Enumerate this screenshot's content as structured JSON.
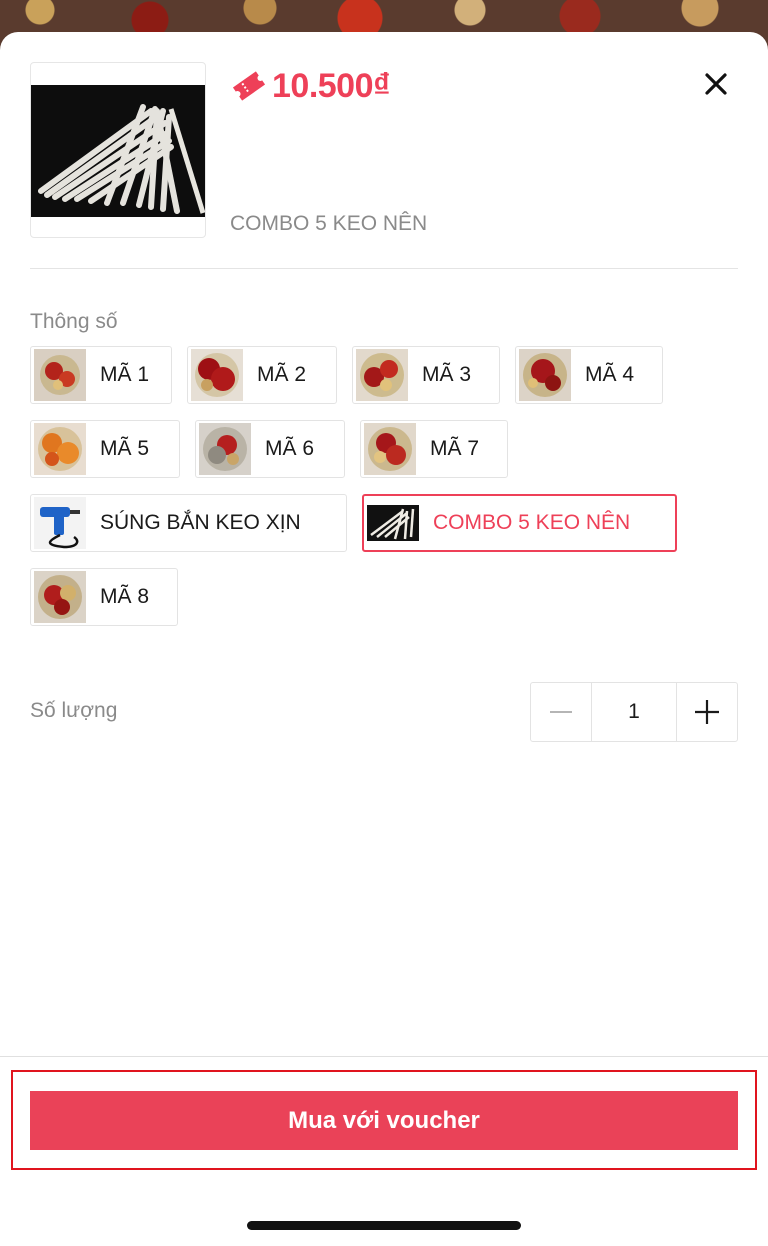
{
  "product": {
    "price": "10.500₫",
    "selected_variant": "COMBO 5 KEO NÊN"
  },
  "spec": {
    "label": "Thông số",
    "options": [
      {
        "label": "MÃ 1"
      },
      {
        "label": "MÃ 2"
      },
      {
        "label": "MÃ 3"
      },
      {
        "label": "MÃ 4"
      },
      {
        "label": "MÃ 5"
      },
      {
        "label": "MÃ 6"
      },
      {
        "label": "MÃ 7"
      },
      {
        "label": "SÚNG BẮN KEO XỊN"
      },
      {
        "label": "COMBO 5 KEO NÊN",
        "selected": true
      },
      {
        "label": "MÃ 8"
      }
    ]
  },
  "quantity": {
    "label": "Số lượng",
    "value": "1"
  },
  "footer": {
    "buy_label": "Mua với voucher"
  },
  "colors": {
    "accent": "#ee4058",
    "button": "#ea4258"
  },
  "icons": {
    "close": "close-icon",
    "price": "ticket-icon",
    "minus": "minus-icon",
    "plus": "plus-icon"
  }
}
